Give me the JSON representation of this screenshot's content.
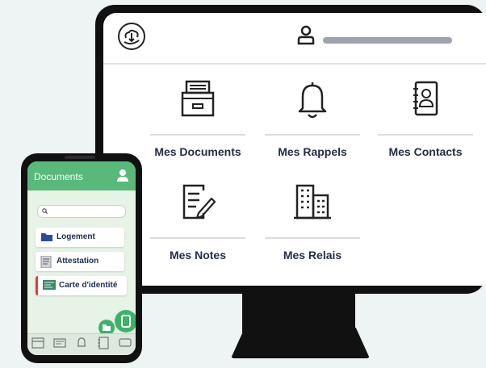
{
  "desktop": {
    "tiles": [
      {
        "label": "Mes Documents",
        "icon": "file-cabinet-icon"
      },
      {
        "label": "Mes Rappels",
        "icon": "bell-icon"
      },
      {
        "label": "Mes Contacts",
        "icon": "address-book-icon"
      },
      {
        "label": "Mes Notes",
        "icon": "note-pencil-icon"
      },
      {
        "label": "Mes Relais",
        "icon": "buildings-icon"
      }
    ]
  },
  "mobile": {
    "header_title": "Documents",
    "items": [
      {
        "label": "Logement",
        "icon": "folder-icon",
        "accent": "#2b4a9a"
      },
      {
        "label": "Attestation",
        "icon": "document-icon",
        "accent": "#2b4a9a"
      },
      {
        "label": "Carte d'identité",
        "icon": "id-card-icon",
        "accent": "#e03b3b"
      }
    ],
    "colors": {
      "header": "#58b97a",
      "fab": "#3db36a"
    }
  }
}
